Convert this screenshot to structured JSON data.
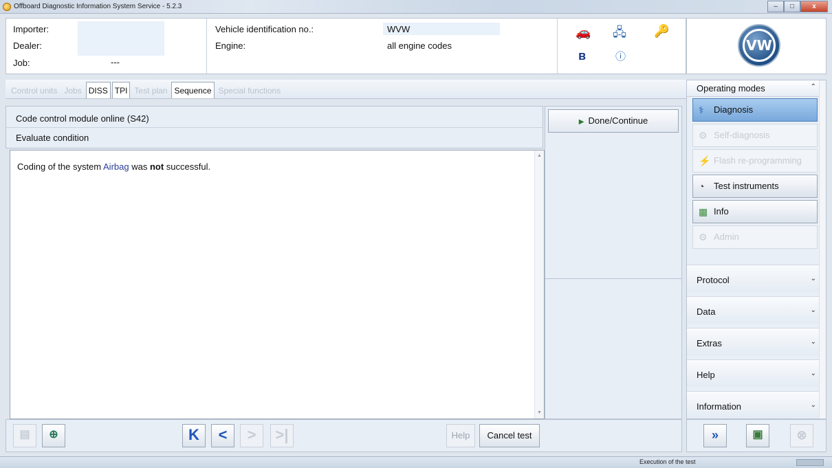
{
  "window": {
    "title": "Offboard Diagnostic Information System Service - 5.2.3",
    "minimize": "–",
    "maximize": "□",
    "close": "x"
  },
  "header": {
    "importer_label": "Importer:",
    "dealer_label": "Dealer:",
    "job_label": "Job:",
    "job_value": "---",
    "vin_label": "Vehicle identification no.:",
    "vin_value": "WVW",
    "engine_label": "Engine:",
    "engine_value": "all engine codes"
  },
  "logo": {
    "text": "VW"
  },
  "tabs": [
    {
      "label": "Control units",
      "enabled": false
    },
    {
      "label": "Jobs",
      "enabled": false
    },
    {
      "label": "DISS",
      "enabled": true
    },
    {
      "label": "TPI",
      "enabled": true
    },
    {
      "label": "Test plan",
      "enabled": false
    },
    {
      "label": "Sequence",
      "enabled": true
    },
    {
      "label": "Special functions",
      "enabled": false
    }
  ],
  "main": {
    "step_title": "Code control module online (S42)",
    "step_subtitle": "Evaluate condition",
    "message": {
      "prefix": "Coding of the system ",
      "system": "Airbag",
      "mid": " was ",
      "emphasis": "not",
      "suffix": " successful."
    }
  },
  "actions": {
    "done_continue": "Done/Continue"
  },
  "bottom_toolbar": {
    "first": "K",
    "prev": "<",
    "next": ">",
    "last": ">|",
    "help": "Help",
    "cancel": "Cancel test"
  },
  "sidebar": {
    "operating_modes_label": "Operating modes",
    "modes": [
      {
        "label": "Diagnosis",
        "state": "active"
      },
      {
        "label": "Self-diagnosis",
        "state": "disabled"
      },
      {
        "label": "Flash re-programming",
        "state": "disabled"
      },
      {
        "label": "Test instruments",
        "state": "enabled"
      },
      {
        "label": "Info",
        "state": "enabled"
      },
      {
        "label": "Admin",
        "state": "disabled"
      }
    ],
    "sections": [
      {
        "label": "Protocol"
      },
      {
        "label": "Data"
      },
      {
        "label": "Extras"
      },
      {
        "label": "Help"
      },
      {
        "label": "Information"
      }
    ]
  },
  "status": {
    "text": "Execution of the test"
  },
  "colors": {
    "accent_blue": "#1f55b8",
    "active_mode": "#78a8dc",
    "link_text": "#2a3e9a"
  }
}
